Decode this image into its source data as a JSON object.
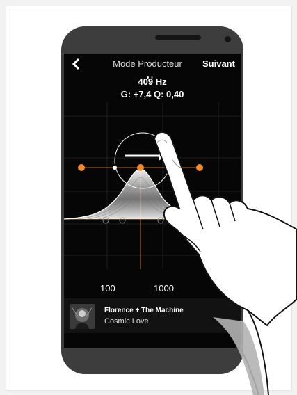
{
  "header": {
    "title": "Mode Producteur",
    "next_label": "Suivant"
  },
  "readout": {
    "frequency": "409 Hz",
    "gain_q": "G: +7,4 Q: 0,40"
  },
  "axis": {
    "labels": [
      "100",
      "1000"
    ]
  },
  "now_playing": {
    "artist": "Florence + The Machine",
    "track": "Cosmic Love"
  },
  "icons": {
    "back": "chevron-left-icon",
    "gesture": "swipe-right-arrow-icon",
    "hand": "pointing-hand-icon"
  },
  "colors": {
    "accent": "#f28a2e",
    "background": "#060606"
  }
}
